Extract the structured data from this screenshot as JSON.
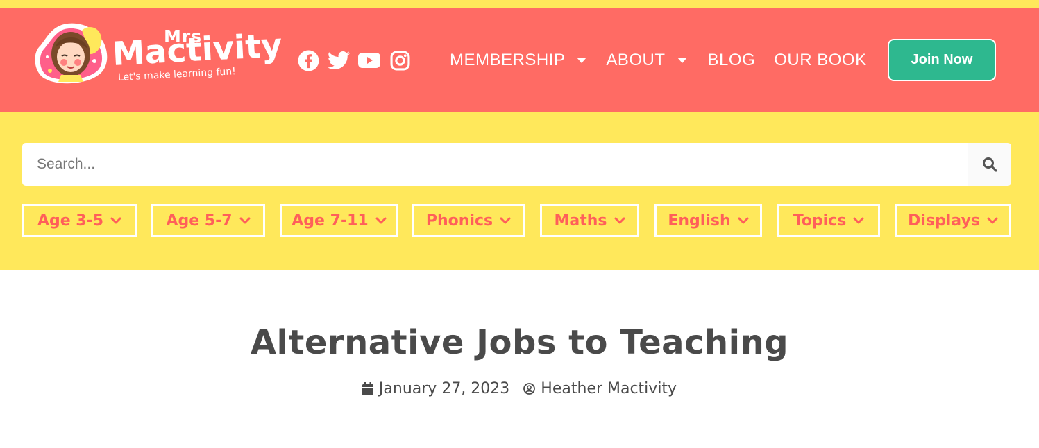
{
  "colors": {
    "header_bg": "#ff6b64",
    "yellow_bg": "#ffe85b",
    "accent_green": "#2eb88f",
    "category_text": "#ff5f5a",
    "title_text": "#4a4a4a"
  },
  "brand": {
    "mrs": "Mrs",
    "name": "Mactivity",
    "tagline": "Let's make learning fun!"
  },
  "socials": [
    {
      "icon": "facebook-icon"
    },
    {
      "icon": "twitter-icon"
    },
    {
      "icon": "youtube-icon"
    },
    {
      "icon": "instagram-icon"
    }
  ],
  "nav": {
    "items": [
      {
        "label": "MEMBERSHIP",
        "has_dropdown": true
      },
      {
        "label": "ABOUT",
        "has_dropdown": true
      },
      {
        "label": "BLOG",
        "has_dropdown": false
      },
      {
        "label": "OUR BOOK",
        "has_dropdown": false
      }
    ],
    "cta": "Join Now"
  },
  "search": {
    "placeholder": "Search...",
    "icon": "search-icon"
  },
  "categories": [
    {
      "label": "Age 3-5"
    },
    {
      "label": "Age 5-7"
    },
    {
      "label": "Age 7-11"
    },
    {
      "label": "Phonics"
    },
    {
      "label": "Maths"
    },
    {
      "label": "English"
    },
    {
      "label": "Topics"
    },
    {
      "label": "Displays"
    }
  ],
  "post": {
    "title": "Alternative Jobs to Teaching",
    "date": "January 27, 2023",
    "author": "Heather Mactivity"
  }
}
